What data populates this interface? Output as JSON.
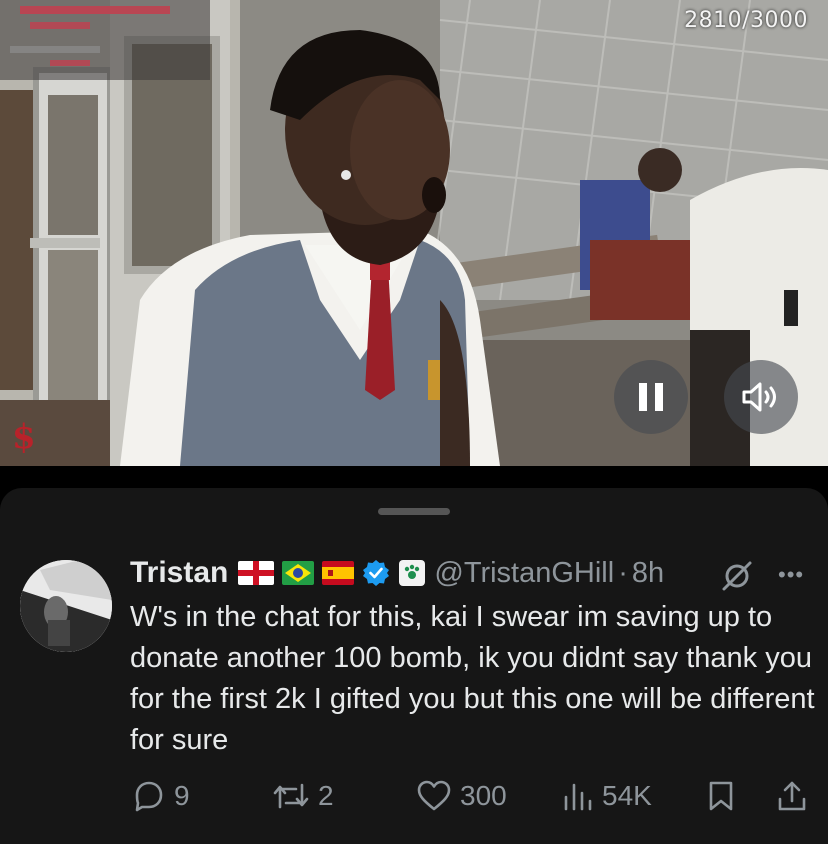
{
  "video": {
    "progress_counter": "2810/3000",
    "controls": {
      "pause_icon": "pause-icon",
      "volume_icon": "speaker-icon"
    }
  },
  "tweet": {
    "author": {
      "name": "Tristan",
      "flags": [
        "england-flag",
        "brazil-flag",
        "spain-flag"
      ],
      "verified": true,
      "handle": "@TristanGHill",
      "separator": "·",
      "time": "8h"
    },
    "text": "W's in the chat for this, kai I swear im saving up to donate another 100 bomb, ik you didnt say thank you for the first 2k I gifted you but this one will be different for sure",
    "actions": {
      "replies": "9",
      "reposts": "2",
      "likes": "300",
      "views": "54K"
    }
  },
  "colors": {
    "background": "#000000",
    "sheet": "#161616",
    "text": "#e7e9ea",
    "muted": "#8e959b",
    "verified": "#1d9bf0"
  }
}
